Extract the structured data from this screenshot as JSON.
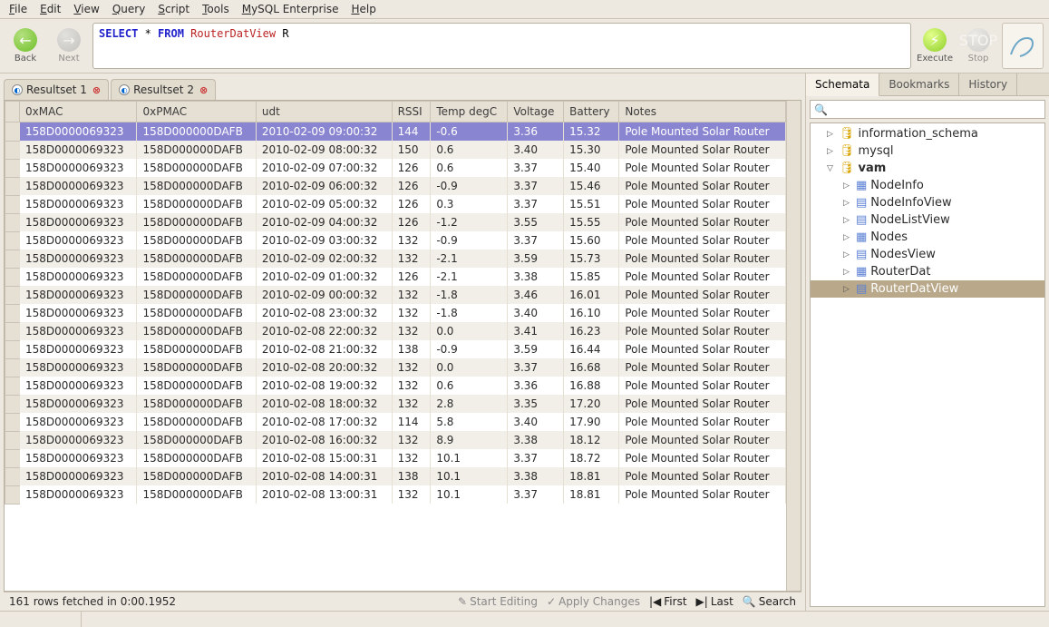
{
  "menu": [
    "File",
    "Edit",
    "View",
    "Query",
    "Script",
    "Tools",
    "MySQL Enterprise",
    "Help"
  ],
  "toolbar": {
    "back": "Back",
    "next": "Next",
    "execute": "Execute",
    "stop": "Stop"
  },
  "query": {
    "select": "SELECT",
    "star": " * ",
    "from": "FROM",
    "table": " RouterDatView ",
    "alias": "R"
  },
  "result_tabs": [
    {
      "label": "Resultset 1"
    },
    {
      "label": "Resultset 2"
    }
  ],
  "columns": [
    "0xMAC",
    "0xPMAC",
    "udt",
    "RSSI",
    "Temp degC",
    "Voltage",
    "Battery",
    "Notes"
  ],
  "rows": [
    [
      "158D0000069323",
      "158D000000DAFB",
      "2010-02-09 09:00:32",
      "144",
      "-0.6",
      "3.36",
      "15.32",
      "Pole Mounted Solar Router"
    ],
    [
      "158D0000069323",
      "158D000000DAFB",
      "2010-02-09 08:00:32",
      "150",
      "0.6",
      "3.40",
      "15.30",
      "Pole Mounted Solar Router"
    ],
    [
      "158D0000069323",
      "158D000000DAFB",
      "2010-02-09 07:00:32",
      "126",
      "0.6",
      "3.37",
      "15.40",
      "Pole Mounted Solar Router"
    ],
    [
      "158D0000069323",
      "158D000000DAFB",
      "2010-02-09 06:00:32",
      "126",
      "-0.9",
      "3.37",
      "15.46",
      "Pole Mounted Solar Router"
    ],
    [
      "158D0000069323",
      "158D000000DAFB",
      "2010-02-09 05:00:32",
      "126",
      "0.3",
      "3.37",
      "15.51",
      "Pole Mounted Solar Router"
    ],
    [
      "158D0000069323",
      "158D000000DAFB",
      "2010-02-09 04:00:32",
      "126",
      "-1.2",
      "3.55",
      "15.55",
      "Pole Mounted Solar Router"
    ],
    [
      "158D0000069323",
      "158D000000DAFB",
      "2010-02-09 03:00:32",
      "132",
      "-0.9",
      "3.37",
      "15.60",
      "Pole Mounted Solar Router"
    ],
    [
      "158D0000069323",
      "158D000000DAFB",
      "2010-02-09 02:00:32",
      "132",
      "-2.1",
      "3.59",
      "15.73",
      "Pole Mounted Solar Router"
    ],
    [
      "158D0000069323",
      "158D000000DAFB",
      "2010-02-09 01:00:32",
      "126",
      "-2.1",
      "3.38",
      "15.85",
      "Pole Mounted Solar Router"
    ],
    [
      "158D0000069323",
      "158D000000DAFB",
      "2010-02-09 00:00:32",
      "132",
      "-1.8",
      "3.46",
      "16.01",
      "Pole Mounted Solar Router"
    ],
    [
      "158D0000069323",
      "158D000000DAFB",
      "2010-02-08 23:00:32",
      "132",
      "-1.8",
      "3.40",
      "16.10",
      "Pole Mounted Solar Router"
    ],
    [
      "158D0000069323",
      "158D000000DAFB",
      "2010-02-08 22:00:32",
      "132",
      "0.0",
      "3.41",
      "16.23",
      "Pole Mounted Solar Router"
    ],
    [
      "158D0000069323",
      "158D000000DAFB",
      "2010-02-08 21:00:32",
      "138",
      "-0.9",
      "3.59",
      "16.44",
      "Pole Mounted Solar Router"
    ],
    [
      "158D0000069323",
      "158D000000DAFB",
      "2010-02-08 20:00:32",
      "132",
      "0.0",
      "3.37",
      "16.68",
      "Pole Mounted Solar Router"
    ],
    [
      "158D0000069323",
      "158D000000DAFB",
      "2010-02-08 19:00:32",
      "132",
      "0.6",
      "3.36",
      "16.88",
      "Pole Mounted Solar Router"
    ],
    [
      "158D0000069323",
      "158D000000DAFB",
      "2010-02-08 18:00:32",
      "132",
      "2.8",
      "3.35",
      "17.20",
      "Pole Mounted Solar Router"
    ],
    [
      "158D0000069323",
      "158D000000DAFB",
      "2010-02-08 17:00:32",
      "114",
      "5.8",
      "3.40",
      "17.90",
      "Pole Mounted Solar Router"
    ],
    [
      "158D0000069323",
      "158D000000DAFB",
      "2010-02-08 16:00:32",
      "132",
      "8.9",
      "3.38",
      "18.12",
      "Pole Mounted Solar Router"
    ],
    [
      "158D0000069323",
      "158D000000DAFB",
      "2010-02-08 15:00:31",
      "132",
      "10.1",
      "3.37",
      "18.72",
      "Pole Mounted Solar Router"
    ],
    [
      "158D0000069323",
      "158D000000DAFB",
      "2010-02-08 14:00:31",
      "138",
      "10.1",
      "3.38",
      "18.81",
      "Pole Mounted Solar Router"
    ],
    [
      "158D0000069323",
      "158D000000DAFB",
      "2010-02-08 13:00:31",
      "132",
      "10.1",
      "3.37",
      "18.81",
      "Pole Mounted Solar Router"
    ]
  ],
  "selected_row": 0,
  "status": {
    "text": "161 rows fetched in 0:00.1952",
    "start_editing": "Start Editing",
    "apply_changes": "Apply Changes",
    "first": "First",
    "last": "Last",
    "search": "Search"
  },
  "right_tabs": [
    "Schemata",
    "Bookmarks",
    "History"
  ],
  "right_tab_active": 0,
  "schemata": {
    "search_placeholder": "",
    "items": [
      {
        "type": "db",
        "label": "information_schema",
        "depth": 1,
        "expand": "closed"
      },
      {
        "type": "db",
        "label": "mysql",
        "depth": 1,
        "expand": "closed"
      },
      {
        "type": "db",
        "label": "vam",
        "depth": 1,
        "expand": "open",
        "bold": true
      },
      {
        "type": "table",
        "label": "NodeInfo",
        "depth": 2,
        "expand": "closed"
      },
      {
        "type": "view",
        "label": "NodeInfoView",
        "depth": 2,
        "expand": "closed"
      },
      {
        "type": "view",
        "label": "NodeListView",
        "depth": 2,
        "expand": "closed"
      },
      {
        "type": "table",
        "label": "Nodes",
        "depth": 2,
        "expand": "closed"
      },
      {
        "type": "view",
        "label": "NodesView",
        "depth": 2,
        "expand": "closed"
      },
      {
        "type": "table",
        "label": "RouterDat",
        "depth": 2,
        "expand": "closed"
      },
      {
        "type": "view",
        "label": "RouterDatView",
        "depth": 2,
        "expand": "closed",
        "selected": true
      }
    ]
  }
}
